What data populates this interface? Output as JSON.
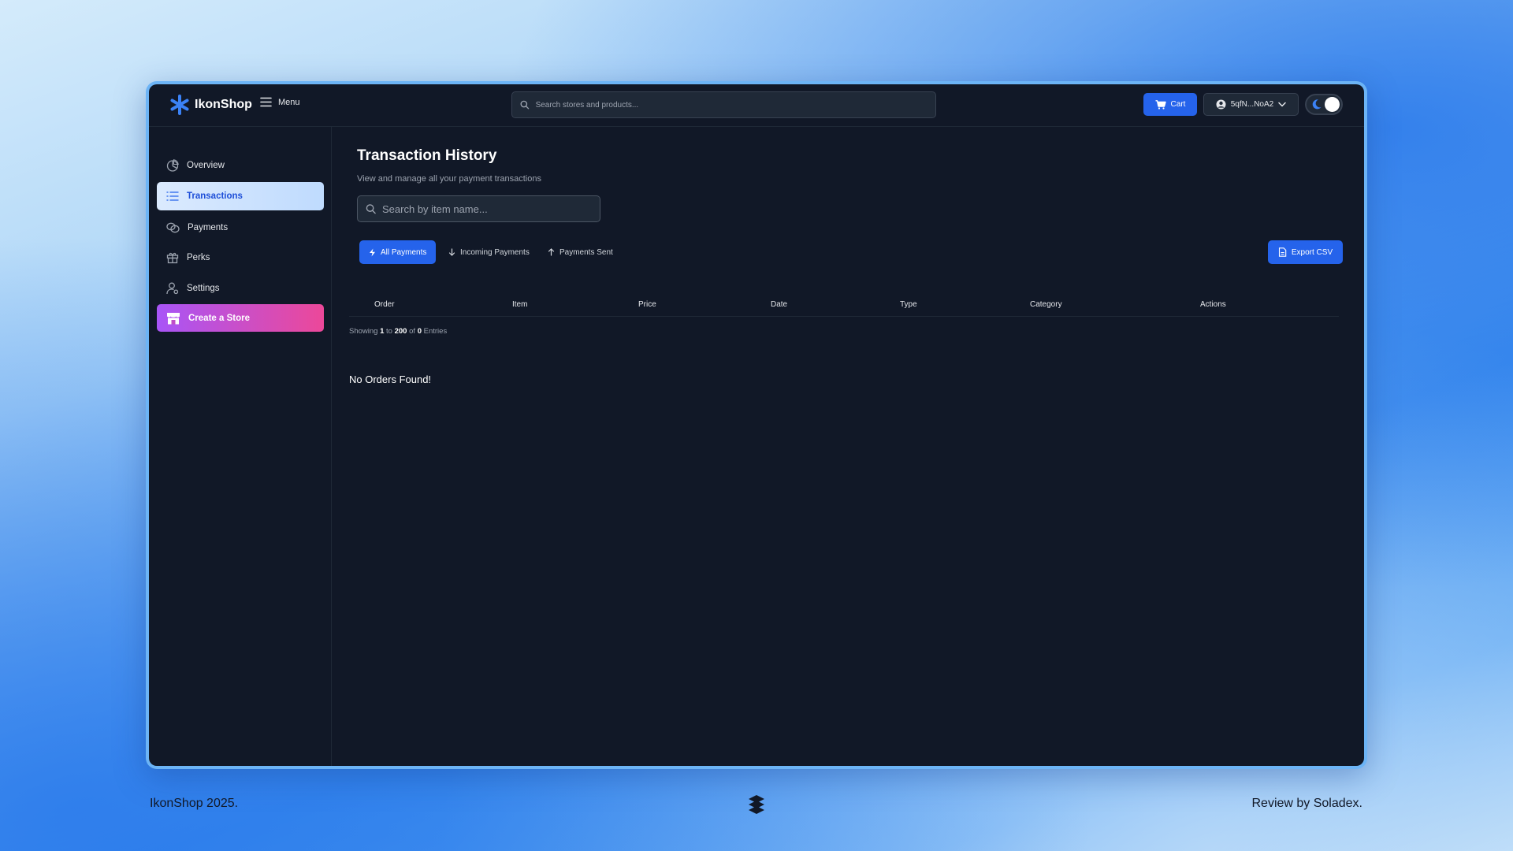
{
  "header": {
    "brand": "IkonShop",
    "menu_label": "Menu",
    "search_placeholder": "Search stores and products...",
    "cart_label": "Cart",
    "wallet_label": "5qfN...NoA2"
  },
  "sidebar": {
    "items": [
      {
        "label": "Overview",
        "icon": "pie-chart-icon",
        "active": false
      },
      {
        "label": "Transactions",
        "icon": "list-icon",
        "active": true
      },
      {
        "label": "Payments",
        "icon": "coins-icon",
        "active": false
      },
      {
        "label": "Perks",
        "icon": "gift-icon",
        "active": false
      },
      {
        "label": "Settings",
        "icon": "user-gear-icon",
        "active": false
      }
    ],
    "create_store_label": "Create a Store"
  },
  "main": {
    "title": "Transaction History",
    "subtitle": "View and manage all your payment transactions",
    "search_placeholder": "Search by item name...",
    "tabs": [
      {
        "label": "All Payments",
        "icon": "bolt-icon",
        "active": true
      },
      {
        "label": "Incoming Payments",
        "icon": "arrow-down-icon",
        "active": false
      },
      {
        "label": "Payments Sent",
        "icon": "arrow-up-icon",
        "active": false
      }
    ],
    "export_label": "Export CSV",
    "columns": [
      "Order",
      "Item",
      "Price",
      "Date",
      "Type",
      "Category",
      "Actions"
    ],
    "showing": {
      "prefix": "Showing",
      "from": "1",
      "to_word": "to",
      "to": "200",
      "of_word": "of",
      "total": "0",
      "suffix": "Entries"
    },
    "empty_message": "No Orders Found!"
  },
  "footer": {
    "left": "IkonShop 2025.",
    "right": "Review by Soladex."
  },
  "colors": {
    "accent": "#2563eb",
    "background": "#111827",
    "create_gradient_start": "#a855f7",
    "create_gradient_end": "#ec4899"
  }
}
